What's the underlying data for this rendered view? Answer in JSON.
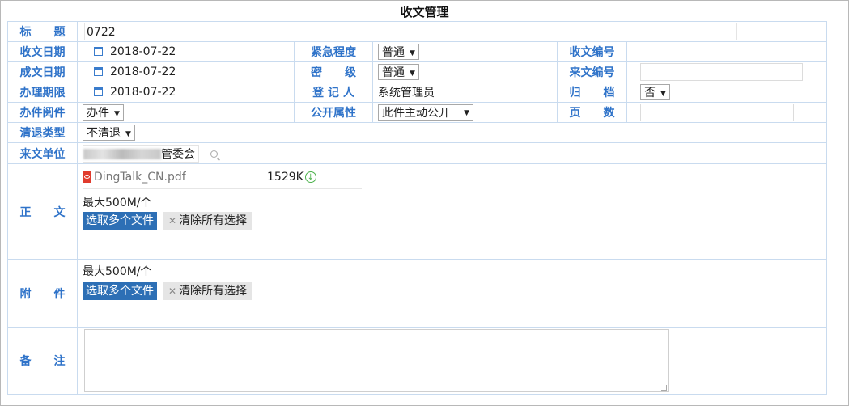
{
  "page": {
    "title": "收文管理"
  },
  "labels": {
    "title": "标　　题",
    "recv_date": "收文日期",
    "urgency": "紧急程度",
    "recv_no": "收文编号",
    "doc_date": "成文日期",
    "security": "密　　级",
    "from_no": "来文编号",
    "deadline": "办理期限",
    "registrar": "登 记 人",
    "archive": "归　　档",
    "doc_kind": "办件阅件",
    "publicity": "公开属性",
    "pages": "页　　数",
    "refund_type": "清退类型",
    "from_unit": "来文单位",
    "body": "正　　文",
    "attachment": "附　　件",
    "remark": "备　　注"
  },
  "values": {
    "title": "0722",
    "recv_date": "2018-07-22",
    "urgency": "普通",
    "recv_no": "",
    "doc_date": "2018-07-22",
    "security": "普通",
    "from_no": "",
    "deadline": "2018-07-22",
    "registrar": "系统管理员",
    "archive": "否",
    "doc_kind": "办件",
    "publicity": "此件主动公开",
    "pages": "",
    "refund_type": "不清退",
    "from_unit_suffix": "管委会"
  },
  "body_file": {
    "name": "DingTalk_CN.pdf",
    "size": "1529K"
  },
  "upload": {
    "limit": "最大500M/个",
    "select_btn": "选取多个文件",
    "clear_btn": "清除所有选择"
  }
}
